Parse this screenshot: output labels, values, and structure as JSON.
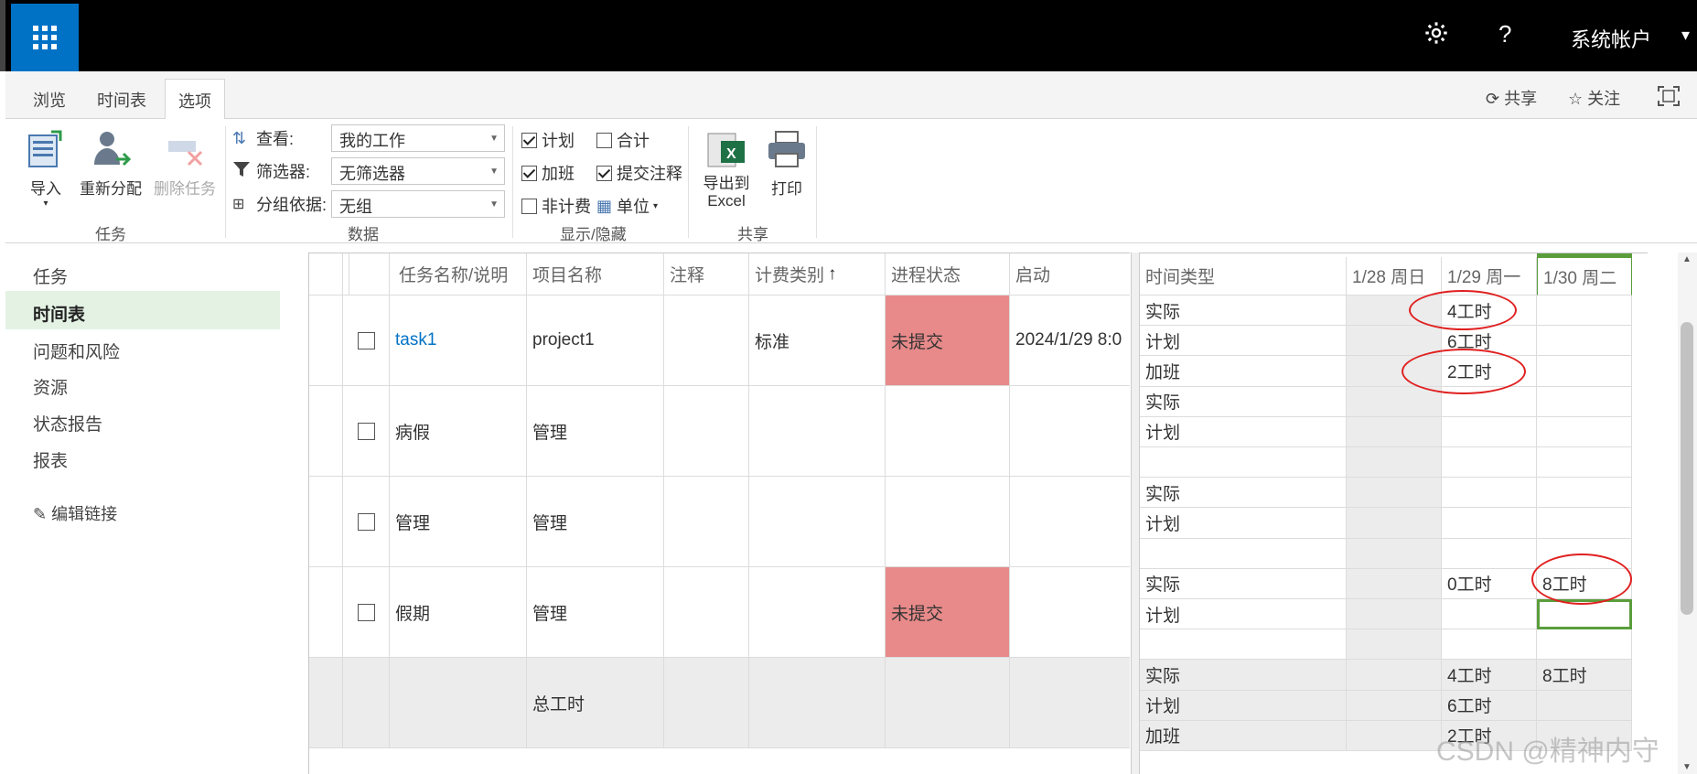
{
  "topbar": {
    "app_launcher_icon": "waffle-icon",
    "settings_icon": "gear-icon",
    "help_label": "?",
    "user_label": "系统帐户",
    "user_caret": "▾"
  },
  "tabs": {
    "items": [
      "浏览",
      "时间表",
      "选项"
    ],
    "active": "选项",
    "share_label": "共享",
    "follow_label": "关注",
    "focus_icon": "focus-mode-icon"
  },
  "ribbon": {
    "groups": {
      "task": "任务",
      "data": "数据",
      "showhide": "显示/隐藏",
      "share": "共享"
    },
    "import_label": "导入",
    "reassign_label": "重新分配",
    "delete_task_label": "删除任务",
    "view_label": "查看:",
    "view_value": "我的工作",
    "filter_label": "筛选器:",
    "filter_value": "无筛选器",
    "group_label": "分组依据:",
    "group_value": "无组",
    "checkboxes": {
      "plan": {
        "label": "计划",
        "checked": true
      },
      "total": {
        "label": "合计",
        "checked": false
      },
      "overtime": {
        "label": "加班",
        "checked": true
      },
      "submit_notes": {
        "label": "提交注释",
        "checked": true
      },
      "nonbill": {
        "label": "非计费",
        "checked": false
      }
    },
    "unit_label": "单位",
    "export_label_1": "导出到",
    "export_label_2": "Excel",
    "print_label": "打印"
  },
  "leftnav": {
    "items": [
      "任务",
      "时间表",
      "问题和风险",
      "资源",
      "状态报告",
      "报表"
    ],
    "active": "时间表",
    "edit_links": "编辑链接"
  },
  "grid": {
    "headers": [
      "任务名称/说明",
      "项目名称",
      "注释",
      "计费类别",
      "进程状态",
      "启动"
    ],
    "sort_arrow": "↑",
    "rows": [
      {
        "task": "task1",
        "project": "project1",
        "note": "",
        "billing": "标准",
        "status": "未提交",
        "start": "2024/1/29 8:0"
      },
      {
        "task": "病假",
        "project": "管理",
        "note": "",
        "billing": "",
        "status": "",
        "start": ""
      },
      {
        "task": "管理",
        "project": "管理",
        "note": "",
        "billing": "",
        "status": "",
        "start": ""
      },
      {
        "task": "假期",
        "project": "管理",
        "note": "",
        "billing": "",
        "status": "未提交",
        "start": ""
      }
    ],
    "total_label": "总工时"
  },
  "timesheet": {
    "headers": [
      "时间类型",
      "1/28 周日",
      "1/29 周一",
      "1/30 周二"
    ],
    "rows": [
      {
        "type": "实际",
        "d1": "",
        "d2": "4工时",
        "d3": ""
      },
      {
        "type": "计划",
        "d1": "",
        "d2": "6工时",
        "d3": ""
      },
      {
        "type": "加班",
        "d1": "",
        "d2": "2工时",
        "d3": ""
      },
      {
        "type": "实际",
        "d1": "",
        "d2": "",
        "d3": ""
      },
      {
        "type": "计划",
        "d1": "",
        "d2": "",
        "d3": ""
      },
      {
        "type": "",
        "d1": "",
        "d2": "",
        "d3": ""
      },
      {
        "type": "实际",
        "d1": "",
        "d2": "",
        "d3": ""
      },
      {
        "type": "计划",
        "d1": "",
        "d2": "",
        "d3": ""
      },
      {
        "type": "",
        "d1": "",
        "d2": "",
        "d3": ""
      },
      {
        "type": "实际",
        "d1": "",
        "d2": "0工时",
        "d3": "8工时"
      },
      {
        "type": "计划",
        "d1": "",
        "d2": "",
        "d3": ""
      },
      {
        "type": "",
        "d1": "",
        "d2": "",
        "d3": ""
      },
      {
        "type": "实际",
        "d1": "",
        "d2": "4工时",
        "d3": "8工时"
      },
      {
        "type": "计划",
        "d1": "",
        "d2": "6工时",
        "d3": ""
      },
      {
        "type": "加班",
        "d1": "",
        "d2": "2工时",
        "d3": ""
      }
    ]
  },
  "watermark": "CSDN @精神内守",
  "colors": {
    "brand": "#0072c6",
    "status_red": "#e88a8a",
    "today_green": "#5a9e3c",
    "nav_active": "#e4f2e4"
  }
}
